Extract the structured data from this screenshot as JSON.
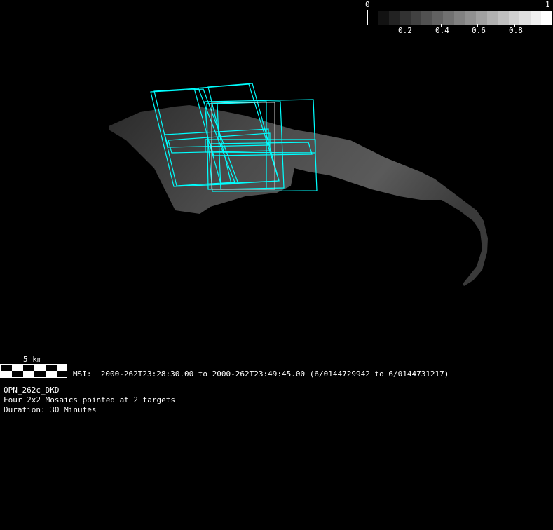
{
  "colorbar": {
    "min_label": "0",
    "max_label": "1",
    "tick_labels": [
      "0.2",
      "0.4",
      "0.6",
      "0.8"
    ],
    "steps": 16
  },
  "scale_bar": {
    "label": "5 km"
  },
  "instrument_line": "MSI:  2000-262T23:28:30.00 to 2000-262T23:49:45.00 (6/0144729942 to 6/0144731217)",
  "info": {
    "sequence_name": "OPN_262c_DKD",
    "description": "Four 2x2 Mosaics pointed at 2 targets",
    "duration": "Duration: 30 Minutes"
  },
  "colors": {
    "footprint": "#00ffff",
    "background": "#000000"
  }
}
